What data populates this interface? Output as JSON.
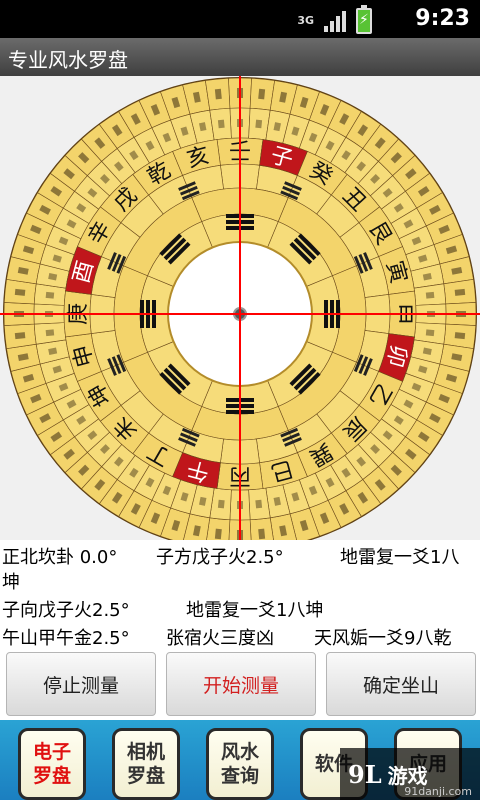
{
  "statusbar": {
    "network": "3G",
    "time": "9:23"
  },
  "app": {
    "title": "专业风水罗盘"
  },
  "compass": {
    "ring_outer_labels": [
      "壬",
      "子",
      "癸",
      "丑",
      "艮",
      "寅",
      "甲",
      "卯",
      "乙",
      "辰",
      "巽",
      "巳",
      "丙",
      "午",
      "丁",
      "未",
      "坤",
      "申",
      "庚",
      "酉",
      "辛",
      "戌",
      "乾",
      "亥"
    ],
    "highlight_color": "#c0161b",
    "ring_color": "#f3d46b"
  },
  "info": {
    "line1_a": "正北坎卦  0.0°",
    "line1_b": "子方戊子火2.5°",
    "line1_c": "地雷复一爻1八",
    "line1_d": "坤",
    "line2_a": "子向戊子火2.5°",
    "line2_b": "地雷复一爻1八坤",
    "line3_a": "午山甲午金2.5°",
    "line3_b": "张宿火三度凶",
    "line3_c": "天风姤一爻9八乾"
  },
  "buttons": {
    "stop": "停止测量",
    "start": "开始测量",
    "confirm": "确定坐山"
  },
  "nav": {
    "tab1_l1": "电子",
    "tab1_l2": "罗盘",
    "tab2_l1": "相机",
    "tab2_l2": "罗盘",
    "tab3_l1": "风水",
    "tab3_l2": "查询",
    "tab4_l1": "软件",
    "tab5_l1": "应用"
  },
  "watermark": {
    "brand": "游戏",
    "logo": "9L",
    "url": "91danji.com"
  }
}
